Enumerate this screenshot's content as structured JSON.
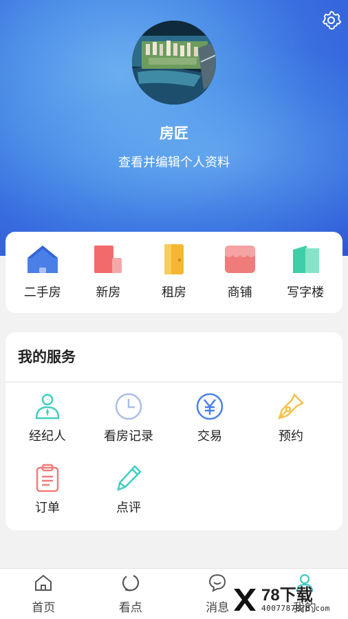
{
  "profile": {
    "name": "房匠",
    "edit_link": "查看并编辑个人资料"
  },
  "categories": [
    {
      "label": "二手房",
      "icon": "house-icon",
      "color": "#4a7fe8"
    },
    {
      "label": "新房",
      "icon": "building-icon",
      "color": "#f26b6b"
    },
    {
      "label": "租房",
      "icon": "door-icon",
      "color": "#f5b731"
    },
    {
      "label": "商铺",
      "icon": "shop-icon",
      "color": "#f07b7b"
    },
    {
      "label": "写字楼",
      "icon": "office-icon",
      "color": "#3ecfa8"
    }
  ],
  "services": {
    "title": "我的服务",
    "items": [
      {
        "label": "经纪人",
        "icon": "agent-icon"
      },
      {
        "label": "看房记录",
        "icon": "clock-icon"
      },
      {
        "label": "交易",
        "icon": "yen-icon"
      },
      {
        "label": "预约",
        "icon": "pen-nib-icon"
      },
      {
        "label": "订单",
        "icon": "clipboard-icon"
      },
      {
        "label": "点评",
        "icon": "pencil-icon"
      }
    ]
  },
  "tabbar": {
    "items": [
      {
        "label": "首页",
        "icon": "home-icon"
      },
      {
        "label": "看点",
        "icon": "circle-loop-icon"
      },
      {
        "label": "消息",
        "icon": "chat-icon"
      },
      {
        "label": "我的",
        "icon": "user-icon",
        "active": true
      }
    ]
  },
  "watermark": {
    "brand": "78下载",
    "phone": "4007787878.com"
  }
}
